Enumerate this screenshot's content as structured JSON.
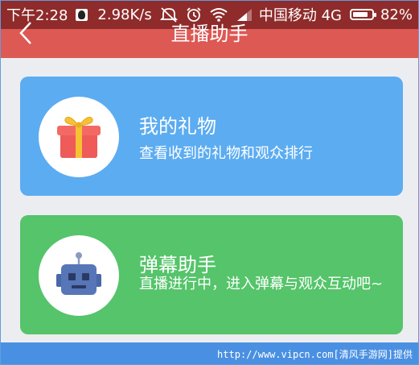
{
  "status_bar": {
    "time": "下午2:28",
    "network_speed": "2.98K/s",
    "carrier": "中国移动 4G",
    "battery_percent": "82%",
    "battery_level": 0.82,
    "icons": [
      "qq-icon",
      "mute-icon",
      "alarm-icon",
      "wifi-icon",
      "signal-icon",
      "battery-icon"
    ]
  },
  "header": {
    "title": "直播助手",
    "background": "#dd5954"
  },
  "cards": [
    {
      "title": "我的礼物",
      "description": "查看收到的礼物和观众排行",
      "icon": "gift-icon",
      "color": "#5cacf1"
    },
    {
      "title": "弹幕助手",
      "description": "直播进行中，进入弹幕与观众互动吧~",
      "icon": "robot-icon",
      "color": "#55c46a"
    }
  ],
  "watermark": "http://www.vipcn.com[清风手游网]提供"
}
